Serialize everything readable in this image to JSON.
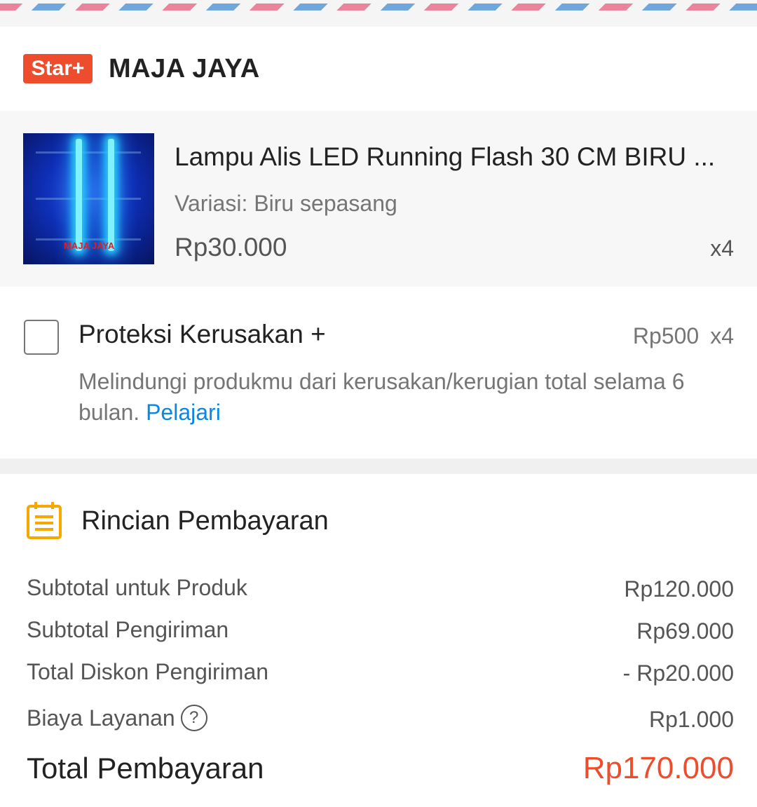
{
  "shop": {
    "badge": "Star+",
    "name": "MAJA JAYA"
  },
  "product": {
    "title": "Lampu Alis LED Running Flash 30 CM BIRU ...",
    "variant": "Variasi: Biru sepasang",
    "price": "Rp30.000",
    "quantity": "x4",
    "image_watermark": "MAJA JAYA"
  },
  "protection": {
    "title": "Proteksi Kerusakan +",
    "price": "Rp500",
    "quantity": "x4",
    "description": "Melindungi produkmu dari kerusakan/kerugian total selama 6 bulan.",
    "link_label": "Pelajari",
    "checked": false
  },
  "payment": {
    "title": "Rincian Pembayaran",
    "rows": [
      {
        "label": "Subtotal untuk Produk",
        "value": "Rp120.000"
      },
      {
        "label": "Subtotal Pengiriman",
        "value": "Rp69.000"
      },
      {
        "label": "Total Diskon Pengiriman",
        "value": "- Rp20.000"
      },
      {
        "label": "Biaya Layanan",
        "value": "Rp1.000"
      }
    ],
    "help_glyph": "?",
    "total_label": "Total Pembayaran",
    "total_value": "Rp170.000"
  },
  "colors": {
    "accent": "#ee4d2d",
    "link": "#0a87e0",
    "icon_yellow": "#f6a700"
  }
}
